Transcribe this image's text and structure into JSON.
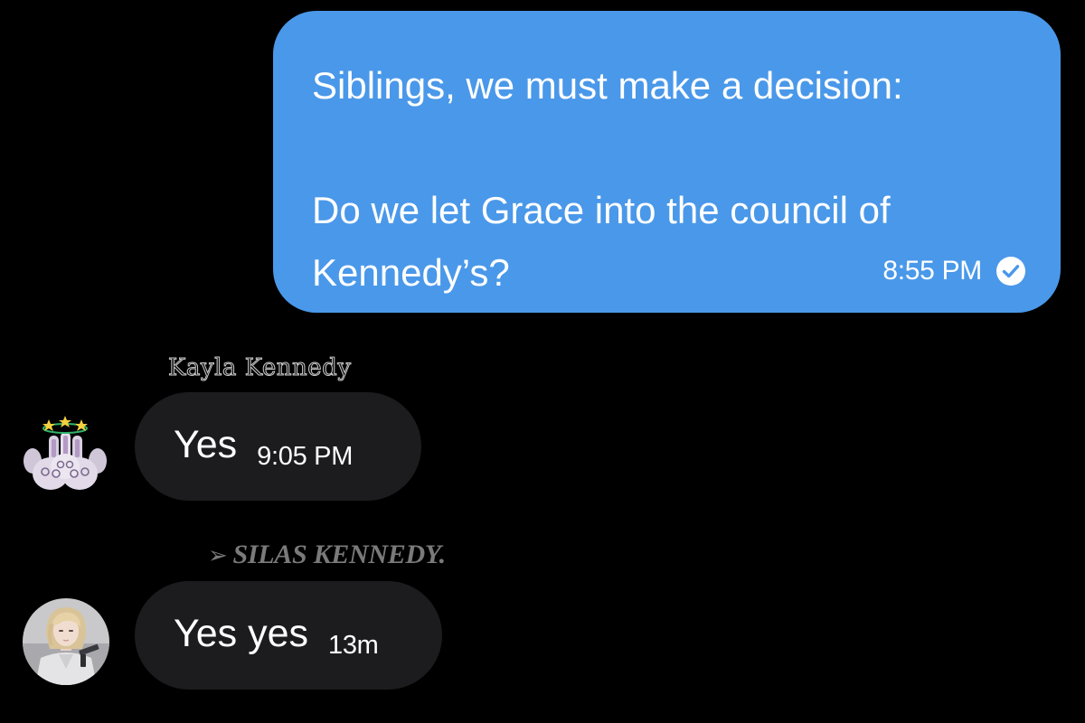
{
  "messages": [
    {
      "direction": "outgoing",
      "text": "Siblings, we must make a decision:\n\nDo we let Grace into the council of Kennedy’s?",
      "time": "8:55 PM",
      "status_icon": "check-circle-icon",
      "bubble_color": "#4a98e9"
    },
    {
      "direction": "incoming",
      "sender": "Kayla Kennedy",
      "avatar_icon": "bunny-halo-avatar",
      "text": "Yes",
      "time": "9:05 PM",
      "bubble_color": "#1c1c1e"
    },
    {
      "direction": "incoming",
      "sender_prefix": "➢",
      "sender": "SILAS KENNEDY.",
      "avatar_icon": "blonde-character-avatar",
      "text": "Yes yes",
      "time": "13m",
      "bubble_color": "#1c1c1e"
    }
  ],
  "colors": {
    "background": "#000000",
    "outgoing_bubble": "#4a98e9",
    "incoming_bubble": "#1c1c1e"
  }
}
